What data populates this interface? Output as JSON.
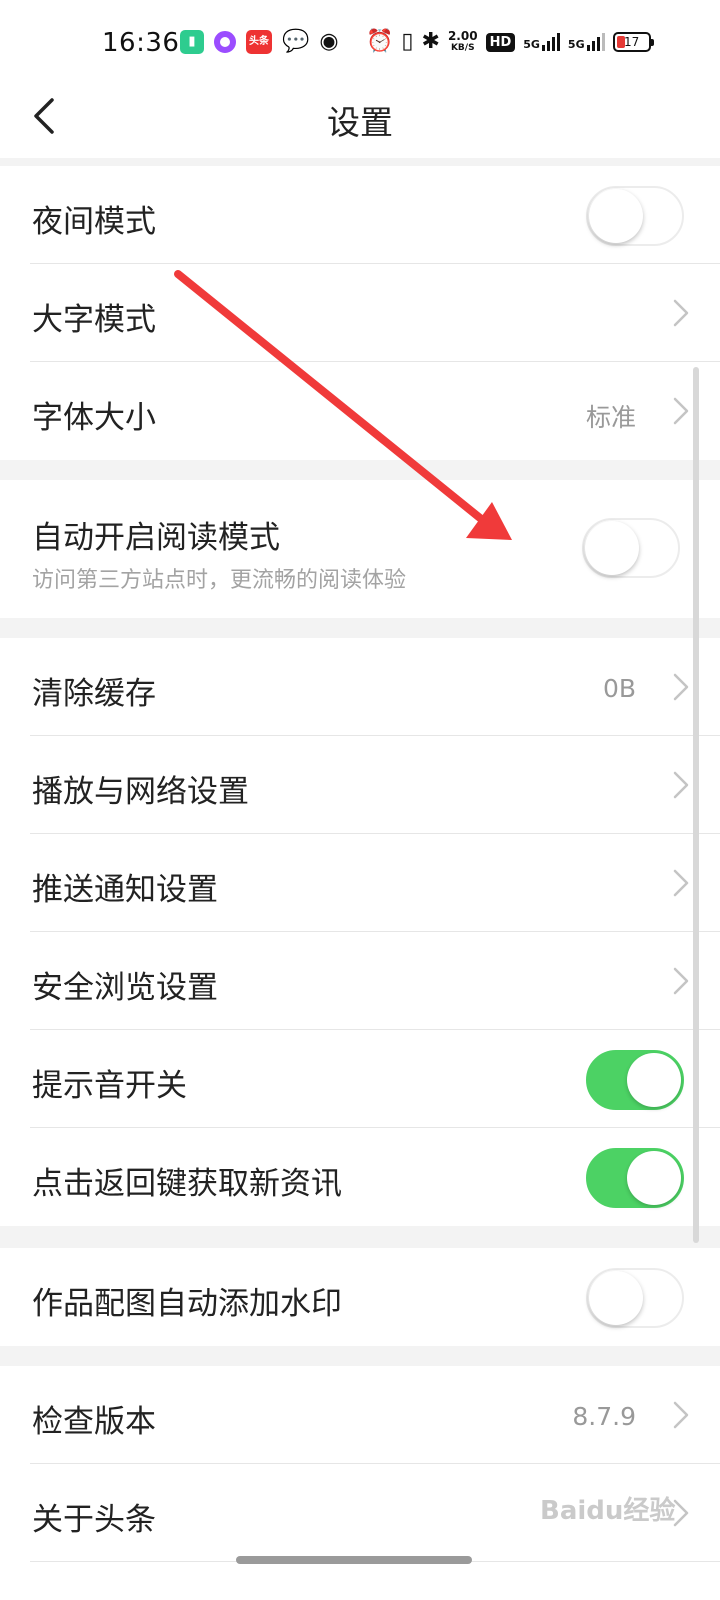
{
  "status_bar": {
    "time": "16:36",
    "toutiao_chip": "头条",
    "speed_value": "2.00",
    "speed_unit": "KB/S",
    "hd_badge": "HD",
    "net1": "5G",
    "net2": "5G",
    "battery": "17"
  },
  "header": {
    "title": "设置"
  },
  "display": {
    "night_mode": {
      "label": "夜间模式",
      "on": false
    },
    "large_text": {
      "label": "大字模式"
    },
    "font_size": {
      "label": "字体大小",
      "value": "标准"
    }
  },
  "reading": {
    "label": "自动开启阅读模式",
    "subtitle": "访问第三方站点时，更流畅的阅读体验",
    "on": false
  },
  "general": {
    "clear_cache": {
      "label": "清除缓存",
      "value": "0B"
    },
    "playback_network": {
      "label": "播放与网络设置"
    },
    "push_notifications": {
      "label": "推送通知设置"
    },
    "safe_browsing": {
      "label": "安全浏览设置"
    },
    "sound": {
      "label": "提示音开关",
      "on": true
    },
    "back_refresh": {
      "label": "点击返回键获取新资讯",
      "on": true
    }
  },
  "watermark_section": {
    "label": "作品配图自动添加水印",
    "on": false
  },
  "about_section": {
    "check_version": {
      "label": "检查版本",
      "value": "8.7.9"
    },
    "about": {
      "label": "关于头条"
    }
  },
  "overlay": {
    "watermark_text": "Baidu经验"
  },
  "colors": {
    "toggle_on": "#4cd264",
    "arrow": "#f03a3a"
  }
}
